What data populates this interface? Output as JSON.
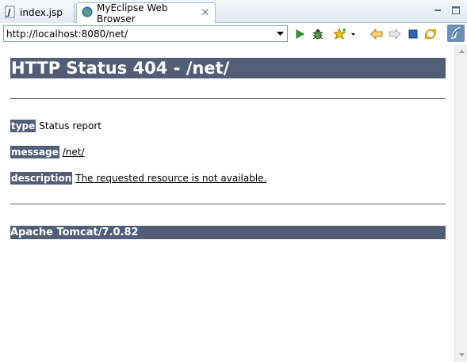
{
  "tabs": [
    {
      "label": "index.jsp",
      "icon": "jsp-file-icon",
      "active": false
    },
    {
      "label": "MyEclipse Web Browser",
      "icon": "globe-icon",
      "active": true
    }
  ],
  "window_controls": {
    "minimize_icon": "minimize-icon",
    "maximize_icon": "maximize-icon"
  },
  "toolbar": {
    "url": "http://localhost:8080/net/",
    "icons": [
      "go-icon",
      "debug-bug-icon",
      "favorites-star-icon",
      "back-arrow-icon",
      "forward-arrow-icon",
      "stop-icon",
      "refresh-icon",
      "myeclipse-logo-icon"
    ]
  },
  "page": {
    "title": "HTTP Status 404 - /net/",
    "rows": [
      {
        "label": "type",
        "value": "Status report"
      },
      {
        "label": "message",
        "value": "/net/"
      },
      {
        "label": "description",
        "value": "The requested resource is not available."
      }
    ],
    "footer": "Apache Tomcat/7.0.82"
  },
  "colors": {
    "header_bg": "#525d76",
    "header_fg": "#ffffff",
    "go_green": "#2e9b2e",
    "nav_arrow": "#e0a030"
  }
}
